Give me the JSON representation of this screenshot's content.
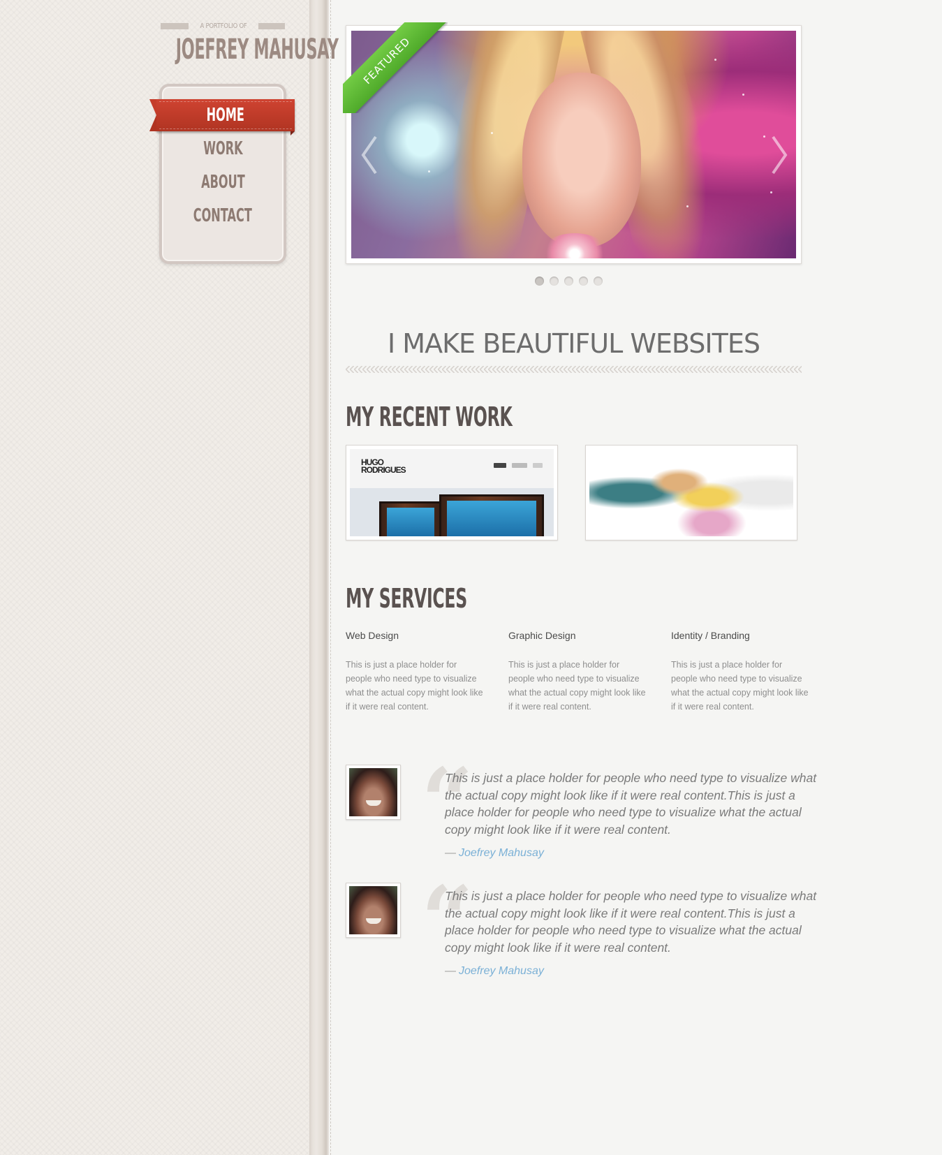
{
  "brand": {
    "subtitle": "A PORTFOLIO OF",
    "name": "JOEFREY MAHUSAY"
  },
  "nav": {
    "items": [
      {
        "label": "HOME",
        "active": true
      },
      {
        "label": "WORK",
        "active": false
      },
      {
        "label": "ABOUT",
        "active": false
      },
      {
        "label": "CONTACT",
        "active": false
      }
    ]
  },
  "slider": {
    "ribbon": "FEATURED",
    "slide_count": 5,
    "active_slide": 1,
    "prev_icon": "chevron-left-icon",
    "next_icon": "chevron-right-icon"
  },
  "tagline": "I MAKE BEAUTIFUL WEBSITES",
  "recent_work": {
    "title": "MY RECENT WORK",
    "thumb1_logo_line1": "HUGO",
    "thumb1_logo_line2": "RODRIGUES"
  },
  "services": {
    "title": "MY SERVICES",
    "items": [
      {
        "name": "Web Design",
        "text": "This is just a place holder for people who need type to visualize what the actual copy might look like if it were real content."
      },
      {
        "name": "Graphic Design",
        "text": "This is just a place holder for people who need type to visualize what the actual copy might look like if it were real content."
      },
      {
        "name": "Identity / Branding",
        "text": "This is just a place holder for people who need type to visualize what the actual copy might look like if it were real content."
      }
    ]
  },
  "testimonials": [
    {
      "text": "This is just a place holder for people who need type to visualize what the actual copy might look like if it were real content.This is just a place holder for people who need type to visualize what the actual copy might look like if it were real content.",
      "dash": "—",
      "author": "Joefrey Mahusay"
    },
    {
      "text": "This is just a place holder for people who need type to visualize what the actual copy might look like if it were real content.This is just a place holder for people who need type to visualize what the actual copy might look like if it were real content.",
      "dash": "—",
      "author": "Joefrey Mahusay"
    }
  ],
  "colors": {
    "nav_active": "#c23b29",
    "ribbon": "#5cb935",
    "author_link": "#7ab0d6"
  }
}
